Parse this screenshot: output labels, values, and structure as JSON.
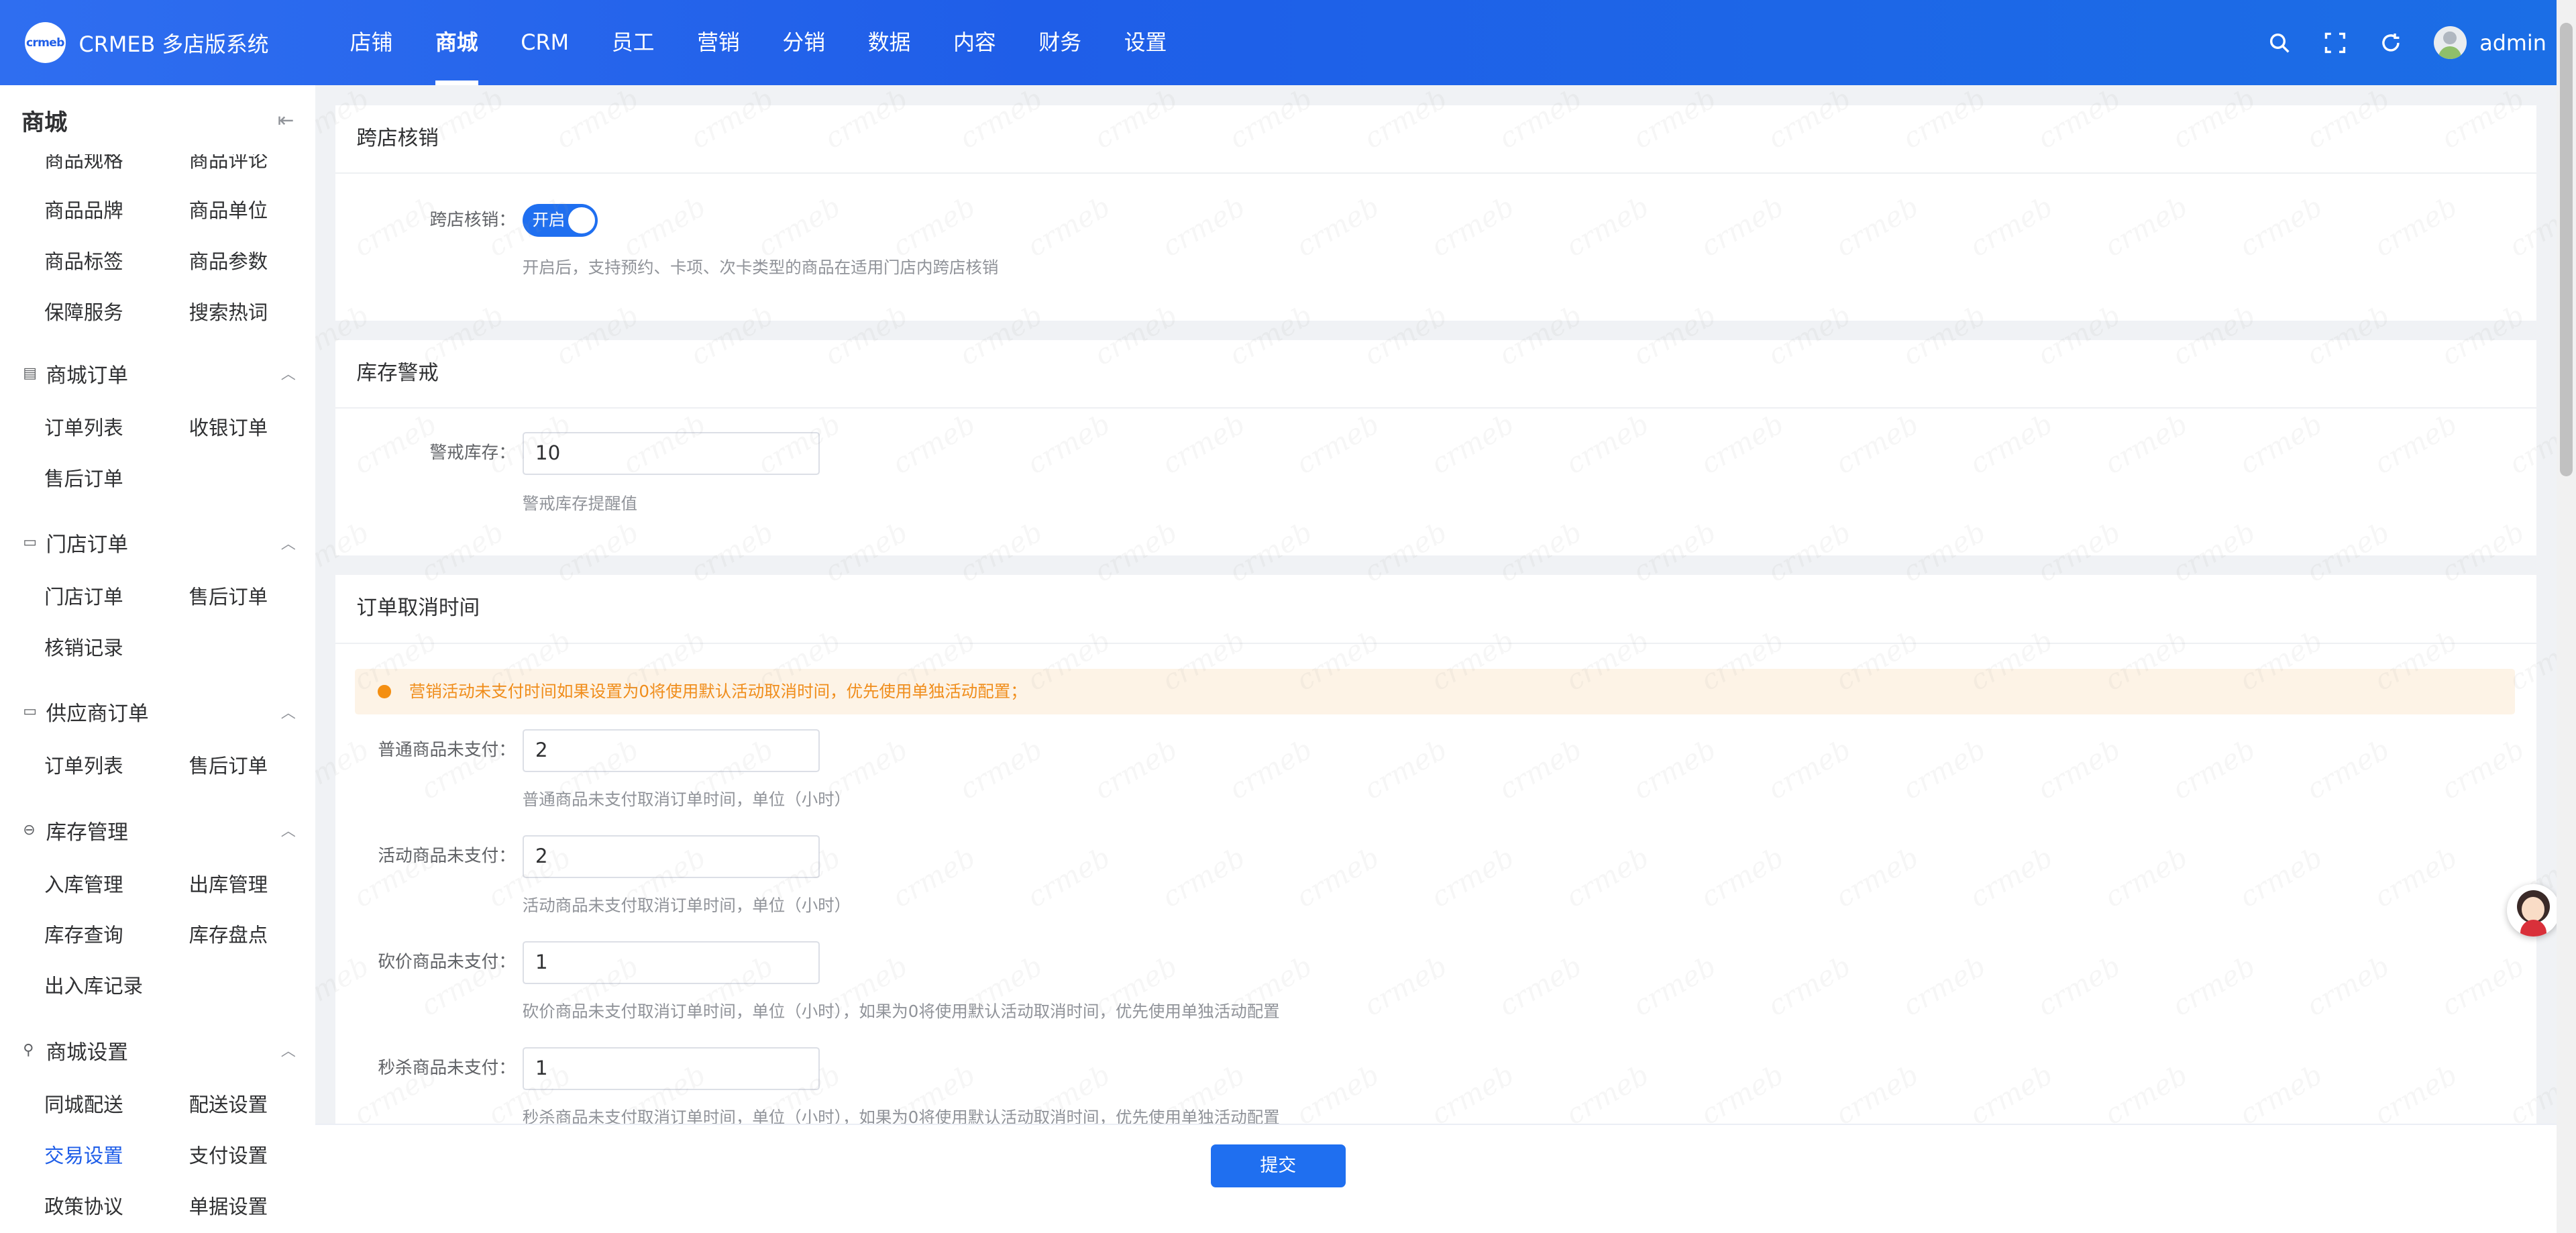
{
  "header": {
    "logo_mark": "crmeb",
    "logo_text": "CRMEB 多店版系统",
    "nav": [
      "店铺",
      "商城",
      "CRM",
      "员工",
      "营销",
      "分销",
      "数据",
      "内容",
      "财务",
      "设置"
    ],
    "active_nav": "商城",
    "user": "admin",
    "icons": [
      "search-icon",
      "fullscreen-icon",
      "refresh-icon"
    ]
  },
  "sidebar": {
    "title": "商城",
    "top_items": [
      "商品规格",
      "商品评论"
    ],
    "rows1": [
      [
        "商品品牌",
        "商品单位"
      ],
      [
        "商品标签",
        "商品参数"
      ],
      [
        "保障服务",
        "搜索热词"
      ]
    ],
    "groups": [
      {
        "label": "商城订单",
        "icon": "list-icon",
        "items": [
          [
            "订单列表",
            "收银订单"
          ],
          [
            "售后订单",
            ""
          ]
        ]
      },
      {
        "label": "门店订单",
        "icon": "window-icon",
        "items": [
          [
            "门店订单",
            "售后订单"
          ],
          [
            "核销记录",
            ""
          ]
        ]
      },
      {
        "label": "供应商订单",
        "icon": "window-icon",
        "items": [
          [
            "订单列表",
            "售后订单"
          ]
        ]
      },
      {
        "label": "库存管理",
        "icon": "box-icon",
        "items": [
          [
            "入库管理",
            "出库管理"
          ],
          [
            "库存查询",
            "库存盘点"
          ],
          [
            "出入库记录",
            ""
          ]
        ]
      },
      {
        "label": "商城设置",
        "icon": "wrench-icon",
        "items": [
          [
            "同城配送",
            "配送设置"
          ],
          [
            "交易设置",
            "支付设置"
          ],
          [
            "政策协议",
            "单据设置"
          ]
        ]
      }
    ],
    "active_item": "交易设置"
  },
  "main": {
    "card1": {
      "title": "跨店核销",
      "label": "跨店核销：",
      "switch_text": "开启",
      "hint": "开启后，支持预约、卡项、次卡类型的商品在适用门店内跨店核销"
    },
    "card2": {
      "title": "库存警戒",
      "label": "警戒库存：",
      "value": "10",
      "hint": "警戒库存提醒值"
    },
    "card3": {
      "title": "订单取消时间",
      "alert": "营销活动未支付时间如果设置为0将使用默认活动取消时间，优先使用单独活动配置；",
      "fields": [
        {
          "label": "普通商品未支付：",
          "value": "2",
          "hint": "普通商品未支付取消订单时间，单位（小时）"
        },
        {
          "label": "活动商品未支付：",
          "value": "2",
          "hint": "活动商品未支付取消订单时间，单位（小时）"
        },
        {
          "label": "砍价商品未支付：",
          "value": "1",
          "hint": "砍价商品未支付取消订单时间，单位（小时），如果为0将使用默认活动取消时间，优先使用单独活动配置"
        },
        {
          "label": "秒杀商品未支付：",
          "value": "1",
          "hint": "秒杀商品未支付取消订单时间，单位（小时），如果为0将使用默认活动取消时间，优先使用单独活动配置"
        }
      ]
    },
    "submit": "提交"
  },
  "watermark_text": "crmeb"
}
